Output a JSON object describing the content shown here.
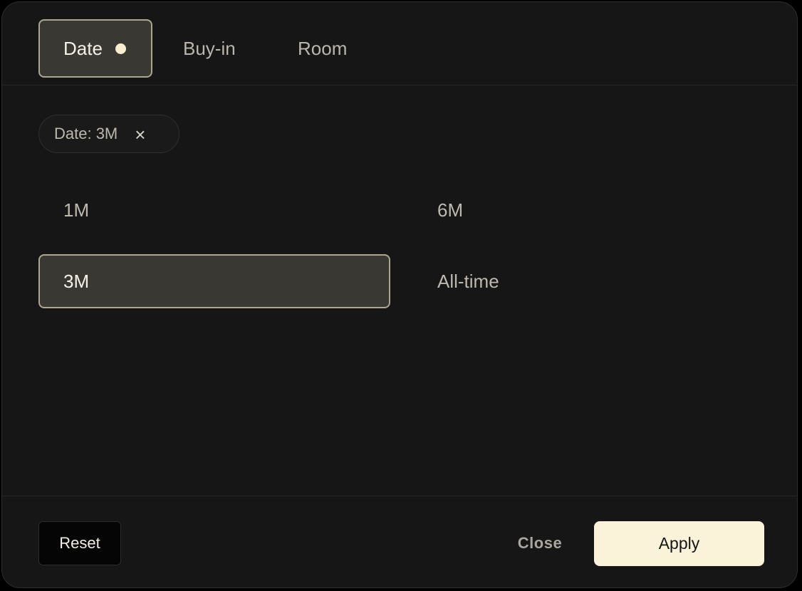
{
  "tabs": [
    {
      "label": "Date",
      "active": true,
      "has_indicator": true
    },
    {
      "label": "Buy-in",
      "active": false
    },
    {
      "label": "Room",
      "active": false
    }
  ],
  "active_filter_chip": {
    "label": "Date: 3M",
    "remove_icon": "×"
  },
  "date_options": [
    {
      "label": "1M",
      "selected": false
    },
    {
      "label": "6M",
      "selected": false
    },
    {
      "label": "3M",
      "selected": true
    },
    {
      "label": "All-time",
      "selected": false
    }
  ],
  "footer": {
    "reset_label": "Reset",
    "close_label": "Close",
    "apply_label": "Apply"
  },
  "colors": {
    "panel_bg": "#161616",
    "selected_bg": "#3a3833",
    "selected_border": "#aaa68f",
    "accent": "#fbf3d9"
  }
}
